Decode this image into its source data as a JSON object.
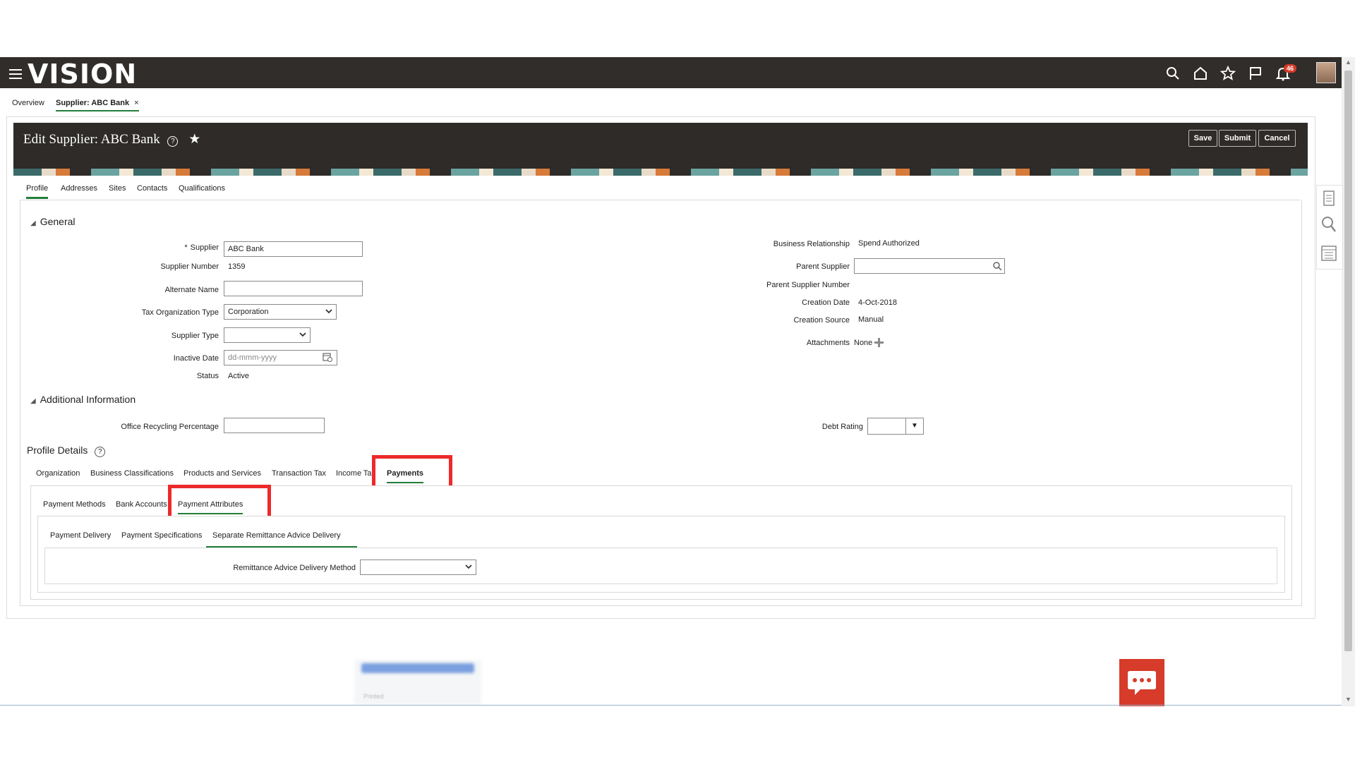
{
  "app": {
    "logo": "VISION",
    "notification_count": "46"
  },
  "page_tabs": [
    {
      "label": "Overview"
    },
    {
      "label": "Supplier: ABC Bank",
      "close": "×"
    }
  ],
  "header": {
    "title": "Edit Supplier: ABC Bank",
    "save": "Save",
    "submit": "Submit",
    "cancel": "Cancel"
  },
  "subtabs": [
    "Profile",
    "Addresses",
    "Sites",
    "Contacts",
    "Qualifications"
  ],
  "general": {
    "section_title": "General",
    "supplier_required": "*",
    "supplier_label": "Supplier",
    "supplier_value": "ABC Bank",
    "supplier_number_label": "Supplier Number",
    "supplier_number": "1359",
    "alternate_name_label": "Alternate Name",
    "tax_org_type_label": "Tax Organization Type",
    "tax_org_type_value": "Corporation",
    "supplier_type_label": "Supplier Type",
    "inactive_date_label": "Inactive Date",
    "inactive_date_placeholder": "dd-mmm-yyyy",
    "status_label": "Status",
    "status_value": "Active",
    "business_relationship_label": "Business Relationship",
    "business_relationship_value": "Spend Authorized",
    "parent_supplier_label": "Parent Supplier",
    "parent_supplier_number_label": "Parent Supplier Number",
    "creation_date_label": "Creation Date",
    "creation_date_value": "4-Oct-2018",
    "creation_source_label": "Creation Source",
    "creation_source_value": "Manual",
    "attachments_label": "Attachments",
    "attachments_value": "None"
  },
  "additional": {
    "section_title": "Additional Information",
    "office_recycling_label": "Office Recycling Percentage",
    "debt_rating_label": "Debt Rating"
  },
  "profile_details": {
    "title": "Profile Details",
    "tabs": [
      "Organization",
      "Business Classifications",
      "Products and Services",
      "Transaction Tax",
      "Income Ta",
      "Payments"
    ],
    "payment_tabs": [
      "Payment Methods",
      "Bank Accounts",
      "Payment Attributes"
    ],
    "attribute_tabs": [
      "Payment Delivery",
      "Payment Specifications",
      "Separate Remittance Advice Delivery"
    ],
    "remittance_label": "Remittance Advice Delivery Method"
  },
  "blurred": {
    "text": "Printed"
  },
  "colors": {
    "topbar": "#312d2a",
    "header": "#2e2b28",
    "active_tab": "#227f3a",
    "highlight": "#ec2a2a",
    "chat": "#d73b2a"
  },
  "icons": [
    "menu-icon",
    "search-icon",
    "home-icon",
    "star-icon",
    "flag-icon",
    "bell-icon",
    "help-icon",
    "favorite-star-icon",
    "calendar-icon",
    "add-icon",
    "chevron-down-icon",
    "document-icon",
    "list-icon",
    "chat-icon"
  ]
}
